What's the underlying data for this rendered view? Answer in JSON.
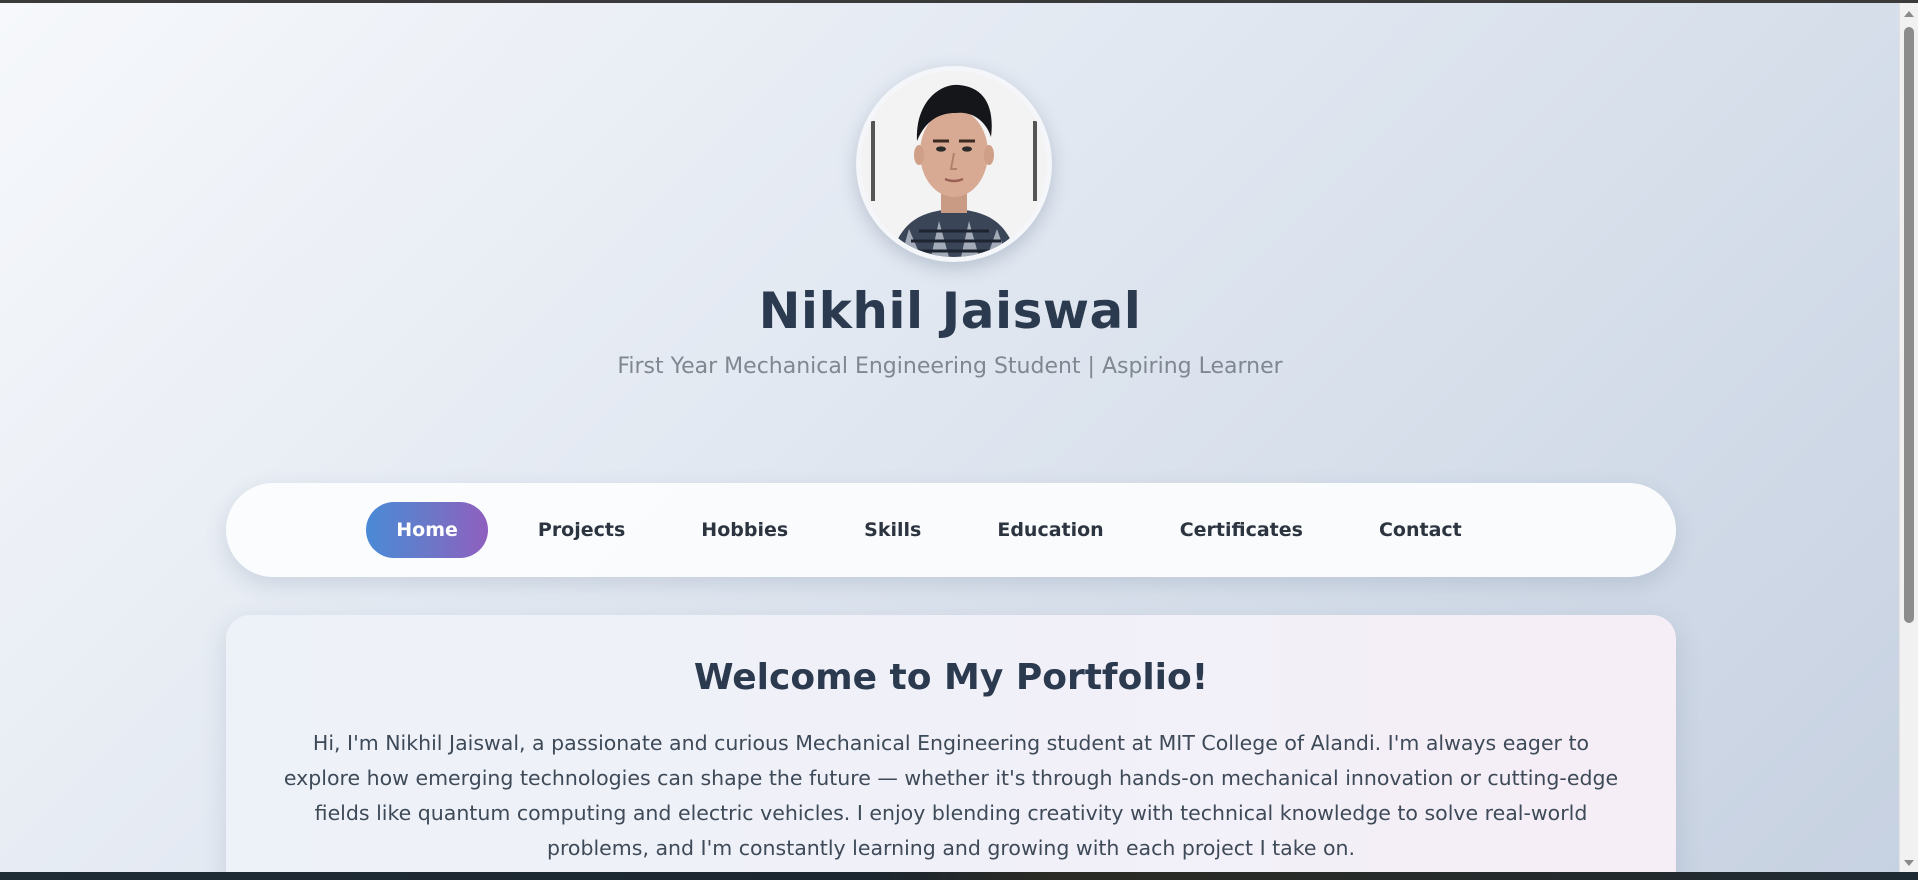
{
  "header": {
    "name": "Nikhil Jaiswal",
    "tagline": "First Year Mechanical Engineering Student | Aspiring Learner",
    "avatar_description": "profile-photo"
  },
  "nav": {
    "items": [
      {
        "label": "Home",
        "active": true
      },
      {
        "label": "Projects",
        "active": false
      },
      {
        "label": "Hobbies",
        "active": false
      },
      {
        "label": "Skills",
        "active": false
      },
      {
        "label": "Education",
        "active": false
      },
      {
        "label": "Certificates",
        "active": false
      },
      {
        "label": "Contact",
        "active": false
      }
    ]
  },
  "welcome": {
    "title": "Welcome to My Portfolio!",
    "text": "Hi, I'm Nikhil Jaiswal, a passionate and curious Mechanical Engineering student at MIT College of Alandi. I'm always eager to explore how emerging technologies can shape the future — whether it's through hands-on mechanical innovation or cutting-edge fields like quantum computing and electric vehicles. I enjoy blending creativity with technical knowledge to solve real-world problems, and I'm constantly learning and growing with each project I take on."
  },
  "theme": {
    "title_color": "#2b3a4e",
    "active_gradient_start": "#4a8ad6",
    "active_gradient_end": "#8f5fbf",
    "background_start": "#f6f8fb",
    "background_end": "#c6d1e1"
  }
}
